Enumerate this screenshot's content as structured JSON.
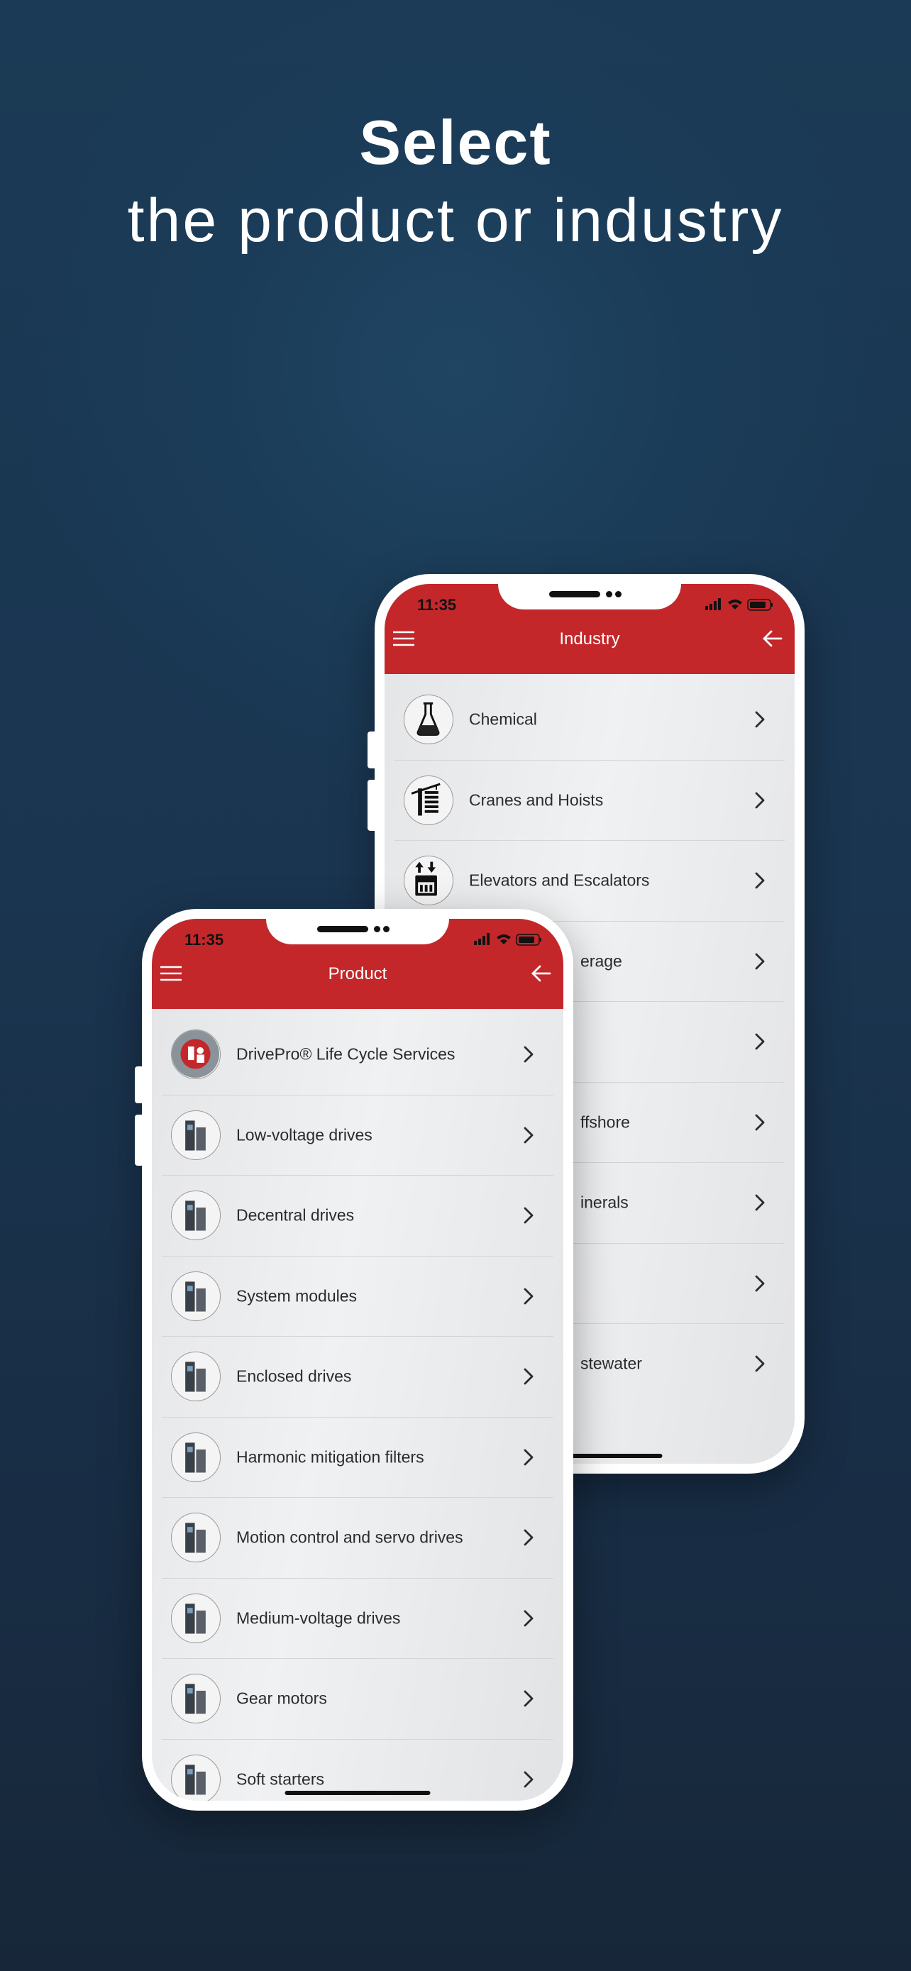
{
  "headline": {
    "line1": "Select",
    "line2": "the product or industry"
  },
  "colors": {
    "header_red": "#c3272a",
    "background": "#1b3a55"
  },
  "industry_phone": {
    "time": "11:35",
    "title": "Industry",
    "menu_icon": "hamburger-icon",
    "back_icon": "arrow-left-icon",
    "items": [
      {
        "label": "Chemical",
        "icon": "flask-icon"
      },
      {
        "label": "Cranes and Hoists",
        "icon": "crane-icon"
      },
      {
        "label": "Elevators and Escalators",
        "icon": "elevator-icon"
      },
      {
        "label": "erage",
        "icon": "",
        "partial": true
      },
      {
        "label": "",
        "icon": "",
        "partial": true
      },
      {
        "label": "ffshore",
        "icon": "",
        "partial": true
      },
      {
        "label": "inerals",
        "icon": "",
        "partial": true
      },
      {
        "label": "",
        "icon": "",
        "partial": true
      },
      {
        "label": "stewater",
        "icon": "",
        "partial": true
      }
    ]
  },
  "product_phone": {
    "time": "11:35",
    "title": "Product",
    "menu_icon": "hamburger-icon",
    "back_icon": "arrow-left-icon",
    "items": [
      {
        "label": "DrivePro® Life Cycle Services",
        "icon": "drivepro-icon"
      },
      {
        "label": "Low-voltage drives",
        "icon": "low-voltage-drive-icon"
      },
      {
        "label": "Decentral drives",
        "icon": "decentral-drive-icon"
      },
      {
        "label": "System modules",
        "icon": "system-modules-icon"
      },
      {
        "label": "Enclosed drives",
        "icon": "enclosed-drive-icon"
      },
      {
        "label": "Harmonic mitigation filters",
        "icon": "harmonic-filter-icon"
      },
      {
        "label": "Motion control and servo drives",
        "icon": "servo-drive-icon"
      },
      {
        "label": "Medium-voltage drives",
        "icon": "medium-voltage-drive-icon"
      },
      {
        "label": "Gear motors",
        "icon": "gear-motor-icon"
      },
      {
        "label": "Soft starters",
        "icon": "soft-starter-icon"
      }
    ]
  }
}
